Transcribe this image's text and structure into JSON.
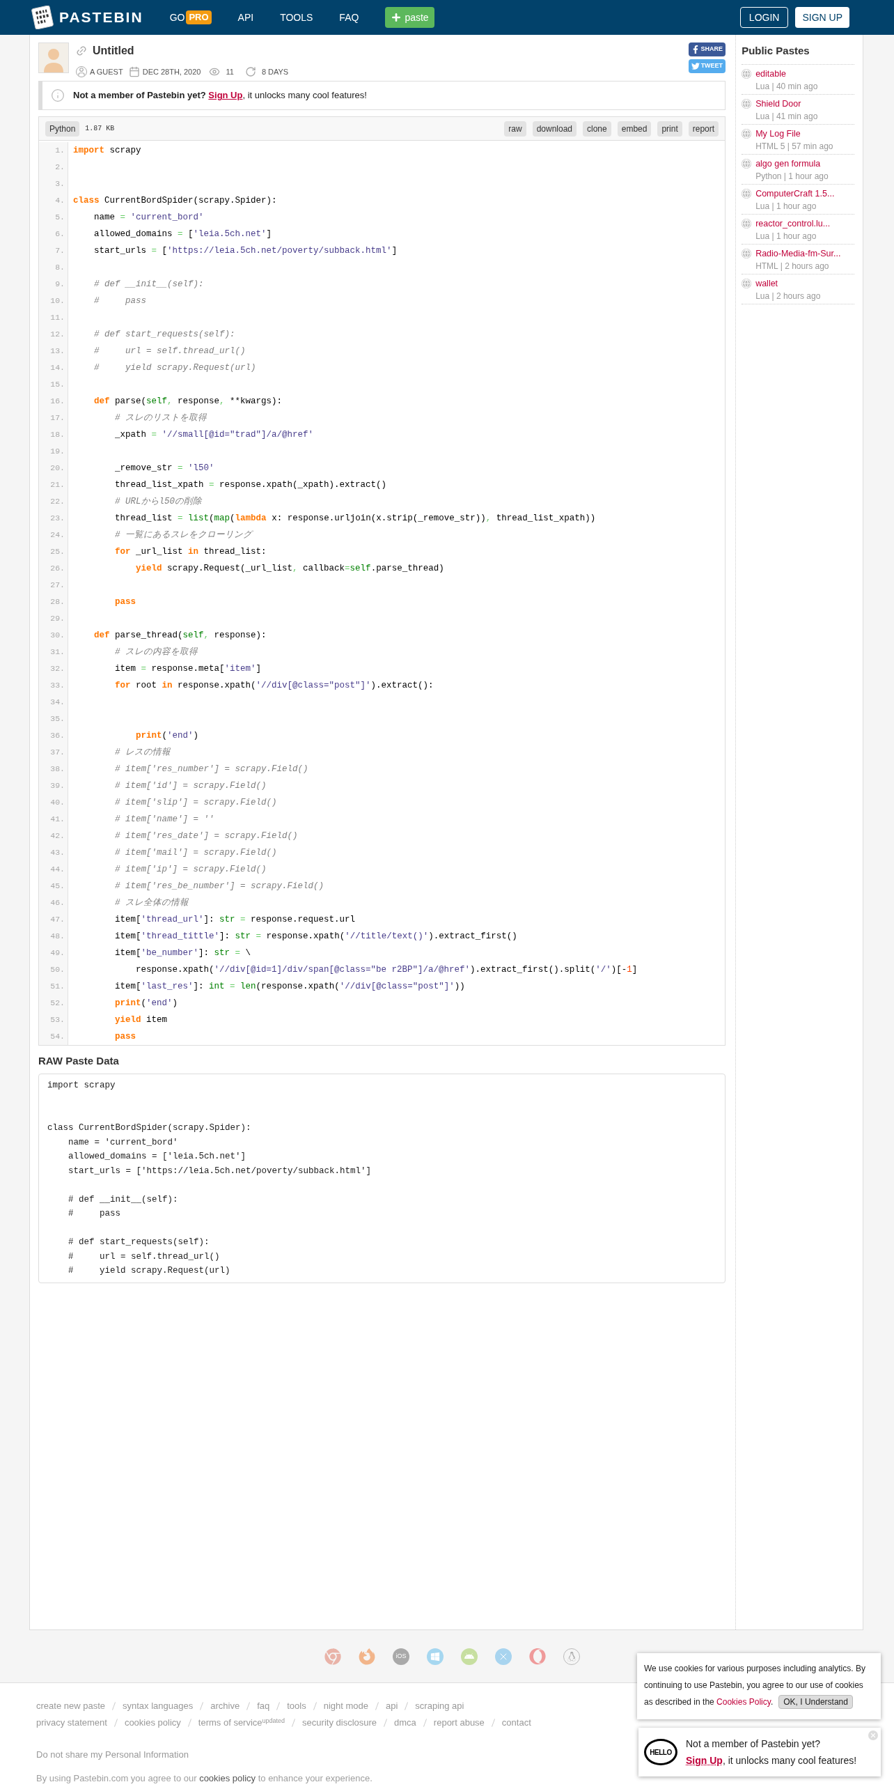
{
  "header": {
    "logo": "PASTEBIN",
    "nav": [
      {
        "kind": "pro",
        "label": "GO",
        "badge": "PRO"
      },
      {
        "kind": "link",
        "label": "API"
      },
      {
        "kind": "link",
        "label": "TOOLS"
      },
      {
        "kind": "link",
        "label": "FAQ"
      }
    ],
    "paste_button": "paste",
    "login": "LOGIN",
    "signup": "SIGN UP"
  },
  "paste": {
    "title": "Untitled",
    "author": "A GUEST",
    "date": "DEC 28TH, 2020",
    "views": "11",
    "expires": "8 DAYS",
    "share": "SHARE",
    "tweet": "TWEET"
  },
  "notice": {
    "lead": "Not a member of Pastebin yet?",
    "link": "Sign Up",
    "rest": ", it unlocks many cool features!"
  },
  "code": {
    "language": "Python",
    "size": "1.87 KB",
    "actions": [
      "raw",
      "download",
      "clone",
      "embed",
      "print",
      "report"
    ],
    "lines": [
      {
        "number": "1.",
        "tokens": [
          {
            "kind": "keyword",
            "text": "import"
          },
          {
            "kind": "plain",
            "text": " scrapy"
          }
        ]
      },
      {
        "number": "2."
      },
      {
        "number": "3."
      },
      {
        "number": "4.",
        "tokens": [
          {
            "kind": "keyword",
            "text": "class"
          },
          {
            "kind": "plain",
            "text": " CurrentBordSpider(scrapy.Spider):"
          }
        ]
      },
      {
        "number": "5.",
        "tokens": [
          {
            "kind": "plain",
            "text": "    name "
          },
          {
            "kind": "operator",
            "text": "="
          },
          {
            "kind": "string",
            "text": " 'current_bord'"
          }
        ]
      },
      {
        "number": "6.",
        "tokens": [
          {
            "kind": "plain",
            "text": "    allowed_domains "
          },
          {
            "kind": "operator",
            "text": "="
          },
          {
            "kind": "plain",
            "text": " ["
          },
          {
            "kind": "string",
            "text": "'leia.5ch.net'"
          },
          {
            "kind": "plain",
            "text": "]"
          }
        ]
      },
      {
        "number": "7.",
        "tokens": [
          {
            "kind": "plain",
            "text": "    start_urls "
          },
          {
            "kind": "operator",
            "text": "="
          },
          {
            "kind": "plain",
            "text": " ["
          },
          {
            "kind": "string",
            "text": "'https://leia.5ch.net/poverty/subback.html'"
          },
          {
            "kind": "plain",
            "text": "]"
          }
        ]
      },
      {
        "number": "8."
      },
      {
        "number": "9.",
        "tokens": [
          {
            "kind": "comment",
            "text": "    # def __init__(self):"
          }
        ]
      },
      {
        "number": "10.",
        "tokens": [
          {
            "kind": "comment",
            "text": "    #     pass"
          }
        ]
      },
      {
        "number": "11."
      },
      {
        "number": "12.",
        "tokens": [
          {
            "kind": "comment",
            "text": "    # def start_requests(self):"
          }
        ]
      },
      {
        "number": "13.",
        "tokens": [
          {
            "kind": "comment",
            "text": "    #     url = self.thread_url()"
          }
        ]
      },
      {
        "number": "14.",
        "tokens": [
          {
            "kind": "comment",
            "text": "    #     yield scrapy.Request(url)"
          }
        ]
      },
      {
        "number": "15."
      },
      {
        "number": "16.",
        "tokens": [
          {
            "kind": "keyword",
            "text": "    def"
          },
          {
            "kind": "plain",
            "text": " parse("
          },
          {
            "kind": "builtin",
            "text": "self"
          },
          {
            "kind": "operator",
            "text": ","
          },
          {
            "kind": "plain",
            "text": " response"
          },
          {
            "kind": "operator",
            "text": ","
          },
          {
            "kind": "plain",
            "text": " **kwargs):"
          }
        ]
      },
      {
        "number": "17.",
        "tokens": [
          {
            "kind": "comment",
            "text": "        # スレのリストを取得"
          }
        ]
      },
      {
        "number": "18.",
        "tokens": [
          {
            "kind": "plain",
            "text": "        _xpath "
          },
          {
            "kind": "operator",
            "text": "="
          },
          {
            "kind": "string",
            "text": " '//small[@id=\"trad\"]/a/@href'"
          }
        ]
      },
      {
        "number": "19."
      },
      {
        "number": "20.",
        "tokens": [
          {
            "kind": "plain",
            "text": "        _remove_str "
          },
          {
            "kind": "operator",
            "text": "="
          },
          {
            "kind": "string",
            "text": " 'l50'"
          }
        ]
      },
      {
        "number": "21.",
        "tokens": [
          {
            "kind": "plain",
            "text": "        thread_list_xpath "
          },
          {
            "kind": "operator",
            "text": "="
          },
          {
            "kind": "plain",
            "text": " response.xpath(_xpath).extract()"
          }
        ]
      },
      {
        "number": "22.",
        "tokens": [
          {
            "kind": "comment",
            "text": "        # URLからl50の削除"
          }
        ]
      },
      {
        "number": "23.",
        "tokens": [
          {
            "kind": "plain",
            "text": "        thread_list "
          },
          {
            "kind": "operator",
            "text": "="
          },
          {
            "kind": "builtin",
            "text": " list"
          },
          {
            "kind": "plain",
            "text": "("
          },
          {
            "kind": "builtin",
            "text": "map"
          },
          {
            "kind": "plain",
            "text": "("
          },
          {
            "kind": "keyword",
            "text": "lambda"
          },
          {
            "kind": "plain",
            "text": " x: response.urljoin(x.strip(_remove_str))"
          },
          {
            "kind": "operator",
            "text": ","
          },
          {
            "kind": "plain",
            "text": " thread_list_xpath))"
          }
        ]
      },
      {
        "number": "24.",
        "tokens": [
          {
            "kind": "comment",
            "text": "        # 一覧にあるスレをクローリング"
          }
        ]
      },
      {
        "number": "25.",
        "tokens": [
          {
            "kind": "keyword",
            "text": "        for"
          },
          {
            "kind": "plain",
            "text": " _url_list "
          },
          {
            "kind": "keyword",
            "text": "in"
          },
          {
            "kind": "plain",
            "text": " thread_list:"
          }
        ]
      },
      {
        "number": "26.",
        "tokens": [
          {
            "kind": "keyword",
            "text": "            yield"
          },
          {
            "kind": "plain",
            "text": " scrapy.Request(_url_list"
          },
          {
            "kind": "operator",
            "text": ","
          },
          {
            "kind": "plain",
            "text": " callback"
          },
          {
            "kind": "operator",
            "text": "="
          },
          {
            "kind": "builtin",
            "text": "self"
          },
          {
            "kind": "plain",
            "text": ".parse_thread)"
          }
        ]
      },
      {
        "number": "27."
      },
      {
        "number": "28.",
        "tokens": [
          {
            "kind": "keyword",
            "text": "        pass"
          }
        ]
      },
      {
        "number": "29."
      },
      {
        "number": "30.",
        "tokens": [
          {
            "kind": "keyword",
            "text": "    def"
          },
          {
            "kind": "plain",
            "text": " parse_thread("
          },
          {
            "kind": "builtin",
            "text": "self"
          },
          {
            "kind": "operator",
            "text": ","
          },
          {
            "kind": "plain",
            "text": " response):"
          }
        ]
      },
      {
        "number": "31.",
        "tokens": [
          {
            "kind": "comment",
            "text": "        # スレの内容を取得"
          }
        ]
      },
      {
        "number": "32.",
        "tokens": [
          {
            "kind": "plain",
            "text": "        item "
          },
          {
            "kind": "operator",
            "text": "="
          },
          {
            "kind": "plain",
            "text": " response.meta["
          },
          {
            "kind": "string",
            "text": "'item'"
          },
          {
            "kind": "plain",
            "text": "]"
          }
        ]
      },
      {
        "number": "33.",
        "tokens": [
          {
            "kind": "keyword",
            "text": "        for"
          },
          {
            "kind": "plain",
            "text": " root "
          },
          {
            "kind": "keyword",
            "text": "in"
          },
          {
            "kind": "plain",
            "text": " response.xpath("
          },
          {
            "kind": "string",
            "text": "'//div[@class=\"post\"]'"
          },
          {
            "kind": "plain",
            "text": ").extract():"
          }
        ]
      },
      {
        "number": "34."
      },
      {
        "number": "35."
      },
      {
        "number": "36.",
        "tokens": [
          {
            "kind": "keyword",
            "text": "            print"
          },
          {
            "kind": "plain",
            "text": "("
          },
          {
            "kind": "string",
            "text": "'end'"
          },
          {
            "kind": "plain",
            "text": ")"
          }
        ]
      },
      {
        "number": "37.",
        "tokens": [
          {
            "kind": "comment",
            "text": "        # レスの情報"
          }
        ]
      },
      {
        "number": "38.",
        "tokens": [
          {
            "kind": "comment",
            "text": "        # item['res_number'] = scrapy.Field()"
          }
        ]
      },
      {
        "number": "39.",
        "tokens": [
          {
            "kind": "comment",
            "text": "        # item['id'] = scrapy.Field()"
          }
        ]
      },
      {
        "number": "40.",
        "tokens": [
          {
            "kind": "comment",
            "text": "        # item['slip'] = scrapy.Field()"
          }
        ]
      },
      {
        "number": "41.",
        "tokens": [
          {
            "kind": "comment",
            "text": "        # item['name'] = ''"
          }
        ]
      },
      {
        "number": "42.",
        "tokens": [
          {
            "kind": "comment",
            "text": "        # item['res_date'] = scrapy.Field()"
          }
        ]
      },
      {
        "number": "43.",
        "tokens": [
          {
            "kind": "comment",
            "text": "        # item['mail'] = scrapy.Field()"
          }
        ]
      },
      {
        "number": "44.",
        "tokens": [
          {
            "kind": "comment",
            "text": "        # item['ip'] = scrapy.Field()"
          }
        ]
      },
      {
        "number": "45.",
        "tokens": [
          {
            "kind": "comment",
            "text": "        # item['res_be_number'] = scrapy.Field()"
          }
        ]
      },
      {
        "number": "46.",
        "tokens": [
          {
            "kind": "comment",
            "text": "        # スレ全体の情報"
          }
        ]
      },
      {
        "number": "47.",
        "tokens": [
          {
            "kind": "plain",
            "text": "        item["
          },
          {
            "kind": "string",
            "text": "'thread_url'"
          },
          {
            "kind": "plain",
            "text": "]: "
          },
          {
            "kind": "builtin",
            "text": "str"
          },
          {
            "kind": "operator",
            "text": " ="
          },
          {
            "kind": "plain",
            "text": " response.request.url"
          }
        ]
      },
      {
        "number": "48.",
        "tokens": [
          {
            "kind": "plain",
            "text": "        item["
          },
          {
            "kind": "string",
            "text": "'thread_tittle'"
          },
          {
            "kind": "plain",
            "text": "]: "
          },
          {
            "kind": "builtin",
            "text": "str"
          },
          {
            "kind": "operator",
            "text": " ="
          },
          {
            "kind": "plain",
            "text": " response.xpath("
          },
          {
            "kind": "string",
            "text": "'//title/text()'"
          },
          {
            "kind": "plain",
            "text": ").extract_first()"
          }
        ]
      },
      {
        "number": "49.",
        "tokens": [
          {
            "kind": "plain",
            "text": "        item["
          },
          {
            "kind": "string",
            "text": "'be_number'"
          },
          {
            "kind": "plain",
            "text": "]: "
          },
          {
            "kind": "builtin",
            "text": "str"
          },
          {
            "kind": "operator",
            "text": " ="
          },
          {
            "kind": "plain",
            "text": " \\"
          }
        ]
      },
      {
        "number": "50.",
        "tokens": [
          {
            "kind": "plain",
            "text": "            response.xpath("
          },
          {
            "kind": "string",
            "text": "'//div[@id=1]/div/span[@class=\"be r2BP\"]/a/@href'"
          },
          {
            "kind": "plain",
            "text": ").extract_first().split("
          },
          {
            "kind": "string",
            "text": "'/'"
          },
          {
            "kind": "plain",
            "text": ")[-"
          },
          {
            "kind": "number",
            "text": "1"
          },
          {
            "kind": "plain",
            "text": "]"
          }
        ]
      },
      {
        "number": "51.",
        "tokens": [
          {
            "kind": "plain",
            "text": "        item["
          },
          {
            "kind": "string",
            "text": "'last_res'"
          },
          {
            "kind": "plain",
            "text": "]: "
          },
          {
            "kind": "builtin",
            "text": "int"
          },
          {
            "kind": "operator",
            "text": " ="
          },
          {
            "kind": "builtin",
            "text": " len"
          },
          {
            "kind": "plain",
            "text": "(response.xpath("
          },
          {
            "kind": "string",
            "text": "'//div[@class=\"post\"]'"
          },
          {
            "kind": "plain",
            "text": "))"
          }
        ]
      },
      {
        "number": "52.",
        "tokens": [
          {
            "kind": "keyword",
            "text": "        print"
          },
          {
            "kind": "plain",
            "text": "("
          },
          {
            "kind": "string",
            "text": "'end'"
          },
          {
            "kind": "plain",
            "text": ")"
          }
        ]
      },
      {
        "number": "53.",
        "tokens": [
          {
            "kind": "keyword",
            "text": "        yield"
          },
          {
            "kind": "plain",
            "text": " item"
          }
        ]
      },
      {
        "number": "54.",
        "tokens": [
          {
            "kind": "keyword",
            "text": "        pass"
          }
        ]
      }
    ]
  },
  "raw_paste": {
    "title": "RAW Paste Data",
    "text": "import scrapy\n\n\nclass CurrentBordSpider(scrapy.Spider):\n    name = 'current_bord'\n    allowed_domains = ['leia.5ch.net']\n    start_urls = ['https://leia.5ch.net/poverty/subback.html']\n\n    # def __init__(self):\n    #     pass\n\n    # def start_requests(self):\n    #     url = self.thread_url()\n    #     yield scrapy.Request(url)"
  },
  "sidebar": {
    "title": "Public Pastes",
    "items": [
      {
        "name": "editable",
        "meta": "Lua | 40 min ago"
      },
      {
        "name": "Shield Door",
        "meta": "Lua | 41 min ago"
      },
      {
        "name": "My Log File",
        "meta": "HTML 5 | 57 min ago"
      },
      {
        "name": "algo gen formula",
        "meta": "Python | 1 hour ago"
      },
      {
        "name": "ComputerCraft 1.5...",
        "meta": "Lua | 1 hour ago"
      },
      {
        "name": "reactor_control.lu...",
        "meta": "Lua | 1 hour ago"
      },
      {
        "name": "Radio-Media-fm-Sur...",
        "meta": "HTML | 2 hours ago"
      },
      {
        "name": "wallet",
        "meta": "Lua | 2 hours ago"
      }
    ]
  },
  "platforms": [
    {
      "kind": "chrome"
    },
    {
      "kind": "firefox"
    },
    {
      "kind": "ios",
      "label": "iOS"
    },
    {
      "kind": "windows"
    },
    {
      "kind": "android"
    },
    {
      "kind": "mac"
    },
    {
      "kind": "opera"
    },
    {
      "kind": "linux"
    }
  ],
  "footer": {
    "links_row_1": [
      "create new paste",
      "syntax languages",
      "archive",
      "faq",
      "tools",
      "night mode",
      "api",
      "scraping api"
    ],
    "links_row_2": [
      "privacy statement",
      "cookies policy",
      "terms of service$^{updated}$",
      "security disclosure",
      "dmca",
      "report abuse",
      "contact"
    ],
    "privacy": "Do not share my Personal Information",
    "consent": {
      "before": "By using Pastebin.com you agree to our ",
      "link": "cookies policy",
      "after": " to enhance your experience."
    }
  },
  "cookie_popup": {
    "text": "We use cookies for various purposes including analytics. By continuing to use Pastebin, you agree to our use of cookies",
    "text_2": "as described in the ",
    "link": "Cookies Policy",
    "after": ".",
    "button": "OK, I Understand"
  },
  "hello_popup": {
    "badge": "HELLO",
    "lead": "Not a member of Pastebin yet?",
    "link": "Sign Up",
    "rest": ", it unlocks many cool features!"
  }
}
